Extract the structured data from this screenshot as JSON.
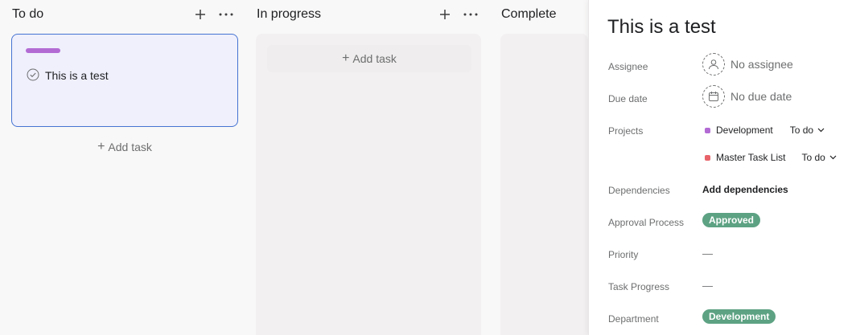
{
  "board": {
    "columns": [
      {
        "title": "To do",
        "add_task": "Add task"
      },
      {
        "title": "In progress",
        "add_task": "Add task"
      },
      {
        "title": "Complete"
      }
    ],
    "task": {
      "title": "This is a test",
      "bar_color": "#b36bd4"
    }
  },
  "details": {
    "title": "This is a test",
    "fields": {
      "assignee": {
        "label": "Assignee",
        "value": "No assignee"
      },
      "due_date": {
        "label": "Due date",
        "value": "No due date"
      },
      "projects": {
        "label": "Projects",
        "items": [
          {
            "name": "Development",
            "status": "To do",
            "color": "#b36bd4"
          },
          {
            "name": "Master Task List",
            "status": "To do",
            "color": "#e8636a"
          }
        ]
      },
      "dependencies": {
        "label": "Dependencies",
        "value": "Add dependencies"
      },
      "approval": {
        "label": "Approval Process",
        "value": "Approved",
        "color": "#5da283"
      },
      "priority": {
        "label": "Priority",
        "value": "—"
      },
      "task_progress": {
        "label": "Task Progress",
        "value": "—"
      },
      "department": {
        "label": "Department",
        "value": "Development",
        "color": "#5da283"
      }
    }
  }
}
